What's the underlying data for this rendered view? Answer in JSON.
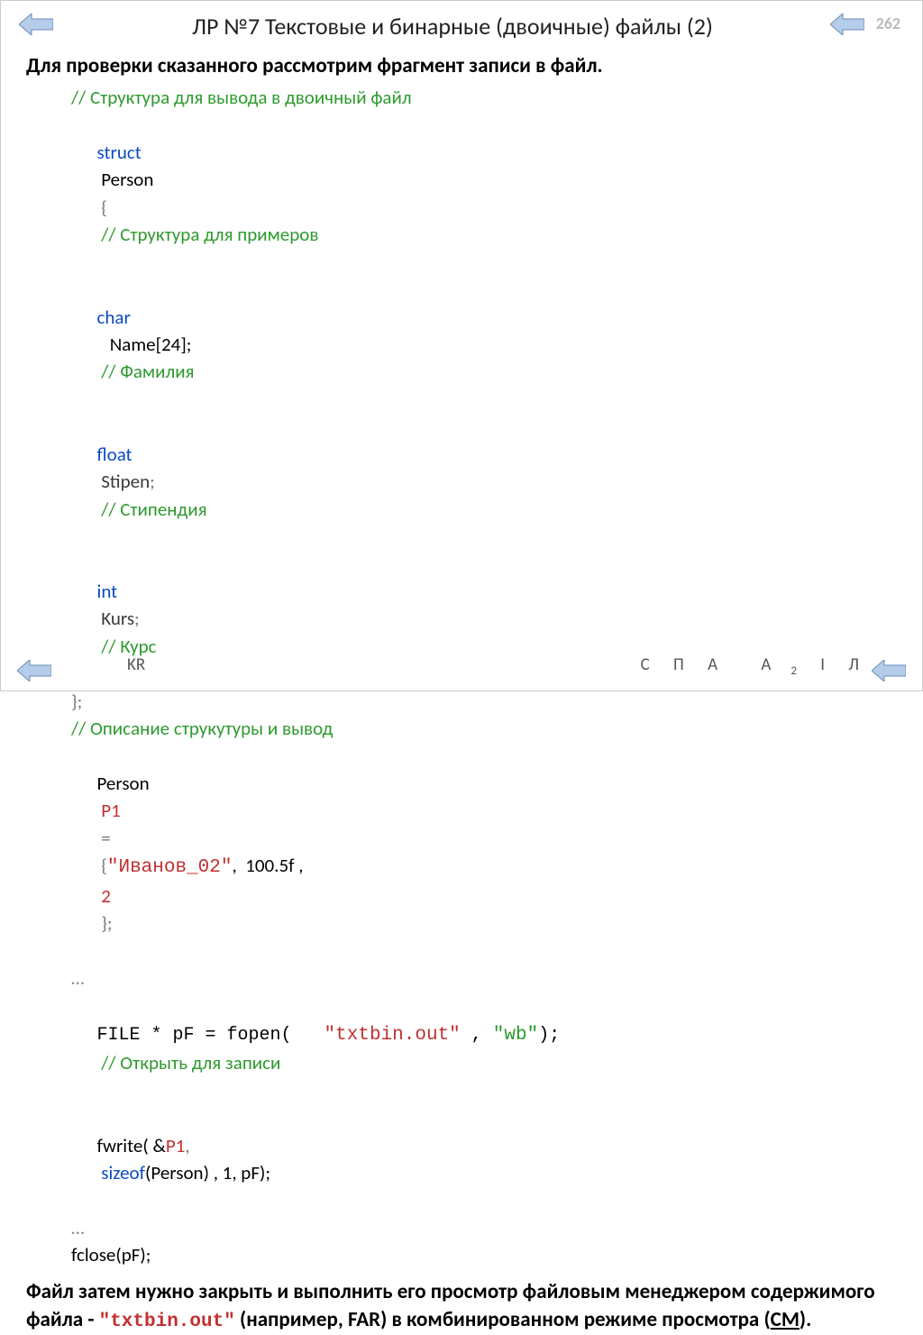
{
  "header": {
    "title": "ЛР №7 Текстовые и бинарные (двоичные) файлы (2)",
    "page_number": "262"
  },
  "intro": "Для проверки сказанного рассмотрим фрагмент записи в файл.",
  "code": {
    "l1_comment": "// Структура для вывода в двоичный файл",
    "l2_kw": "struct",
    "l2_name": "Person",
    "l2_brace": "{",
    "l2_comment": "// Структура для примеров",
    "l3_kw": "char",
    "l3_decl": "Name[24];",
    "l3_comment": "// Фамилия",
    "l4_kw": "float",
    "l4_name": "Stipen",
    "l4_semi": ";",
    "l4_comment": "// Стипендия",
    "l5_kw": "int",
    "l5_name": "Kurs",
    "l5_semi": ";",
    "l5_comment": "// Курс",
    "l6_close": "};",
    "l7_comment": "// Описание струкутуры и вывод",
    "l8_type": "Person",
    "l8_var": "P1",
    "l8_eq": "=",
    "l8_open": "{",
    "l8_str": "\"Иванов_02\"",
    "l8_c1": ",  100.5f ,",
    "l8_num": "2",
    "l8_close": "};",
    "l9_ellipsis": "…",
    "l10_pre": "FILE * pF = fopen(   ",
    "l10_str1": "\"txtbin.out\"",
    "l10_mid": " , ",
    "l10_str2": "\"wb\"",
    "l10_post": ");",
    "l10_comment": "// Открыть для записи",
    "l11_a": "fwrite( &",
    "l11_p1": "P1",
    "l11_c": ",",
    "l11_sizeof": "sizeof",
    "l11_b": "(Person) , 1, pF);",
    "l12_ellipsis": "…",
    "l13": "fclose(pF);"
  },
  "outro": {
    "part1": "Файл затем нужно закрыть и выполнить его просмотр файловым менеджером содержимого файла - ",
    "filename": "\"txtbin.out\"",
    "part2": "  (например, FAR) в комбинированном режиме просмотра (",
    "cm": "СМ",
    "part3": ")."
  },
  "footer": {
    "left": "KR",
    "right": {
      "c": "С",
      "p": "П",
      "a": "А",
      "a2": "А",
      "a2_sub": "2",
      "i": "I",
      "l": "Л"
    }
  }
}
